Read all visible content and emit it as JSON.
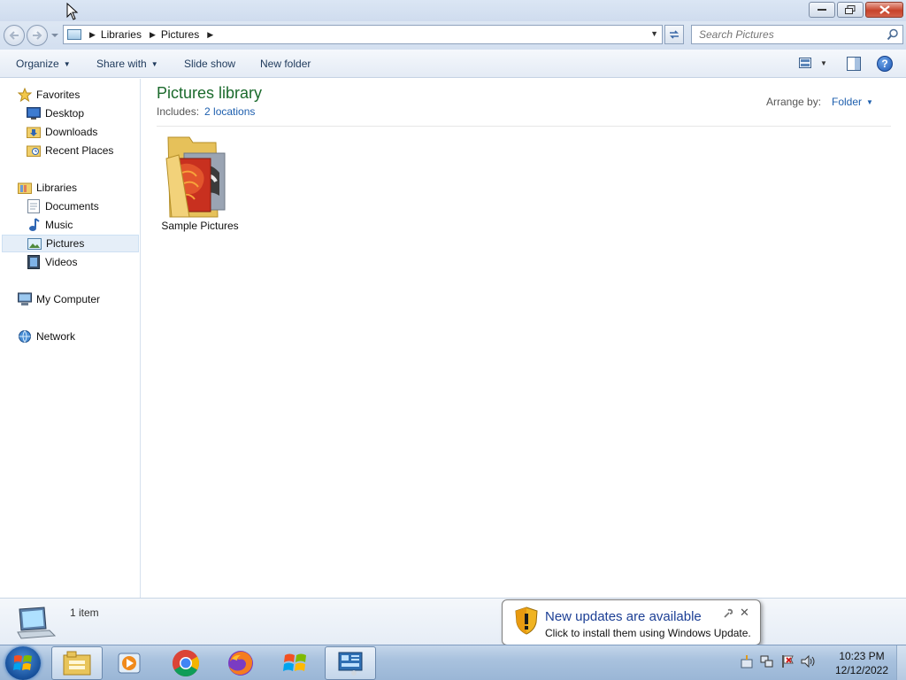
{
  "address": {
    "breadcrumbs": [
      "Libraries",
      "Pictures"
    ]
  },
  "search": {
    "placeholder": "Search Pictures"
  },
  "toolbar": {
    "organize": "Organize",
    "share_with": "Share with",
    "slide_show": "Slide show",
    "new_folder": "New folder"
  },
  "sidebar": {
    "favorites": {
      "label": "Favorites",
      "items": [
        "Desktop",
        "Downloads",
        "Recent Places"
      ]
    },
    "libraries": {
      "label": "Libraries",
      "items": [
        "Documents",
        "Music",
        "Pictures",
        "Videos"
      ]
    },
    "computer": "My Computer",
    "network": "Network",
    "selected": "Pictures"
  },
  "content": {
    "title": "Pictures library",
    "includes_label": "Includes:",
    "includes_link": "2 locations",
    "arrange_label": "Arrange by:",
    "arrange_value": "Folder",
    "items": [
      {
        "name": "Sample Pictures",
        "type": "folder"
      }
    ]
  },
  "details": {
    "count": "1 item"
  },
  "notification": {
    "title": "New updates are available",
    "text": "Click to install them using Windows Update."
  },
  "taskbar": {
    "apps": [
      "windows-explorer",
      "media-player",
      "chrome",
      "firefox",
      "windows-update-flag",
      "control-panel"
    ],
    "time": "10:23 PM",
    "date": "12/12/2022"
  },
  "colors": {
    "library_title": "#1b6a2c",
    "link": "#1e5fae",
    "notification_title": "#1c3f95"
  }
}
